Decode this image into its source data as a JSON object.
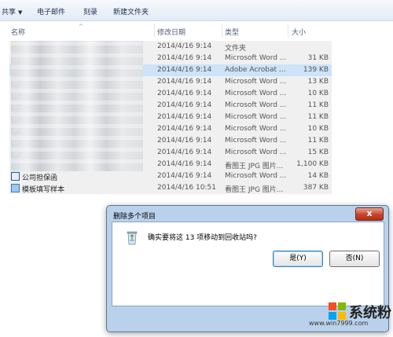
{
  "toolbar": {
    "share": "共享",
    "email": "电子邮件",
    "burn": "刻录",
    "new_folder": "新建文件夹"
  },
  "columns": {
    "name": "名称",
    "date": "修改日期",
    "type": "类型",
    "size": "大小"
  },
  "files": [
    {
      "name": "",
      "date": "2014/4/16 9:14",
      "type": "文件夹",
      "size": ""
    },
    {
      "name": "",
      "date": "2014/4/16 9:14",
      "type": "Microsoft Word ...",
      "size": "31 KB"
    },
    {
      "name": "",
      "date": "2014/4/16 9:14",
      "type": "Adobe Acrobat ...",
      "size": "139 KB",
      "selected": true
    },
    {
      "name": "",
      "date": "2014/4/16 9:14",
      "type": "Microsoft Word ...",
      "size": "13 KB"
    },
    {
      "name": "",
      "date": "2014/4/16 9:14",
      "type": "Microsoft Word ...",
      "size": "10 KB"
    },
    {
      "name": "",
      "date": "2014/4/16 9:14",
      "type": "Microsoft Word ...",
      "size": "11 KB"
    },
    {
      "name": "",
      "date": "2014/4/16 9:14",
      "type": "Microsoft Word ...",
      "size": "11 KB"
    },
    {
      "name": "",
      "date": "2014/4/16 9:14",
      "type": "Microsoft Word ...",
      "size": "10 KB"
    },
    {
      "name": "",
      "date": "2014/4/16 9:14",
      "type": "Microsoft Word ...",
      "size": "11 KB"
    },
    {
      "name": "",
      "date": "2014/4/16 9:14",
      "type": "Microsoft Word ...",
      "size": "15 KB"
    },
    {
      "name": "",
      "date": "2014/4/16 9:14",
      "type": "看图王 JPG 图片...",
      "size": "1,100 KB"
    },
    {
      "name": "公司担保函",
      "date": "2014/4/16 9:14",
      "type": "Microsoft Word ...",
      "size": "14 KB"
    },
    {
      "name": "模板填写样本",
      "date": "2014/4/16 10:51",
      "type": "看图王 JPG 图片...",
      "size": "387 KB"
    }
  ],
  "dialog": {
    "title": "删除多个项目",
    "close_symbol": "x",
    "message": "确实要将这 13 项移动到回收站吗?",
    "yes_label": "是(Y)",
    "no_label": "否(N)"
  },
  "watermark": {
    "brand": "系统粉",
    "url": "www.win7999.com"
  },
  "colors": {
    "selected_row": "#cce3f8",
    "dialog_frame": "#b9d1ea",
    "close_button": "#c7432b"
  }
}
